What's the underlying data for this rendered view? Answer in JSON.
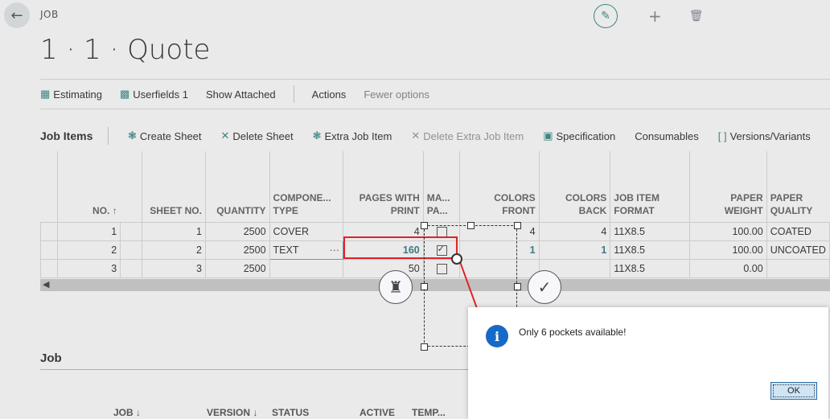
{
  "header": {
    "breadcrumb": "JOB",
    "title": "1 · 1 · Quote"
  },
  "action_bar": {
    "estimating": "Estimating",
    "userfields": "Userfields 1",
    "show_attached": "Show Attached",
    "actions": "Actions",
    "fewer_options": "Fewer options"
  },
  "job_items": {
    "section_title": "Job Items",
    "toolbar": {
      "create_sheet": "Create Sheet",
      "delete_sheet": "Delete Sheet",
      "extra_job_item": "Extra Job Item",
      "delete_extra_job_item": "Delete Extra Job Item",
      "specification": "Specification",
      "consumables": "Consumables",
      "versions_variants": "Versions/Variants"
    },
    "columns": {
      "no": "NO. ↑",
      "sheet_no": "SHEET NO.",
      "quantity": "QUANTITY",
      "component_type_1": "COMPONE...",
      "component_type_2": "TYPE",
      "pages_with_print_1": "PAGES WITH",
      "pages_with_print_2": "PRINT",
      "ma_pa_1": "MA...",
      "ma_pa_2": "PA...",
      "colors_front_1": "COLORS",
      "colors_front_2": "FRONT",
      "colors_back_1": "COLORS",
      "colors_back_2": "BACK",
      "job_item_format_1": "JOB ITEM",
      "job_item_format_2": "FORMAT",
      "paper_weight_1": "PAPER",
      "paper_weight_2": "WEIGHT",
      "paper_quality_1": "PAPER",
      "paper_quality_2": "QUALITY"
    },
    "rows": [
      {
        "no": "1",
        "sheet_no": "1",
        "quantity": "2500",
        "component": "COVER",
        "pages": "4",
        "checked": false,
        "colors_front": "4",
        "colors_back": "4",
        "format": "11X8.5",
        "weight": "100.00",
        "quality": "COATED"
      },
      {
        "no": "2",
        "sheet_no": "2",
        "quantity": "2500",
        "component": "TEXT",
        "pages": "160",
        "checked": true,
        "colors_front": "1",
        "colors_back": "1",
        "format": "11X8.5",
        "weight": "100.00",
        "quality": "UNCOATED"
      },
      {
        "no": "3",
        "sheet_no": "3",
        "quantity": "2500",
        "component": "",
        "pages": "50",
        "checked": false,
        "colors_front": "",
        "colors_back": "",
        "format": "11X8.5",
        "weight": "0.00",
        "quality": ""
      }
    ],
    "ellipsis": "···"
  },
  "job_section": {
    "title": "Job",
    "columns": {
      "job": "JOB ↓",
      "version": "VERSION ↓",
      "status": "STATUS",
      "active": "ACTIVE",
      "temp": "TEMP..."
    }
  },
  "dialog": {
    "message": "Only 6 pockets available!",
    "ok": "OK",
    "info_icon_text": "i"
  },
  "icons": {
    "back": "arrow-left-icon",
    "edit": "pencil-icon",
    "add": "plus-icon",
    "delete": "trash-icon"
  },
  "colors": {
    "accent": "#3a8b86",
    "highlight": "#e0232a",
    "info": "#1769c7"
  }
}
